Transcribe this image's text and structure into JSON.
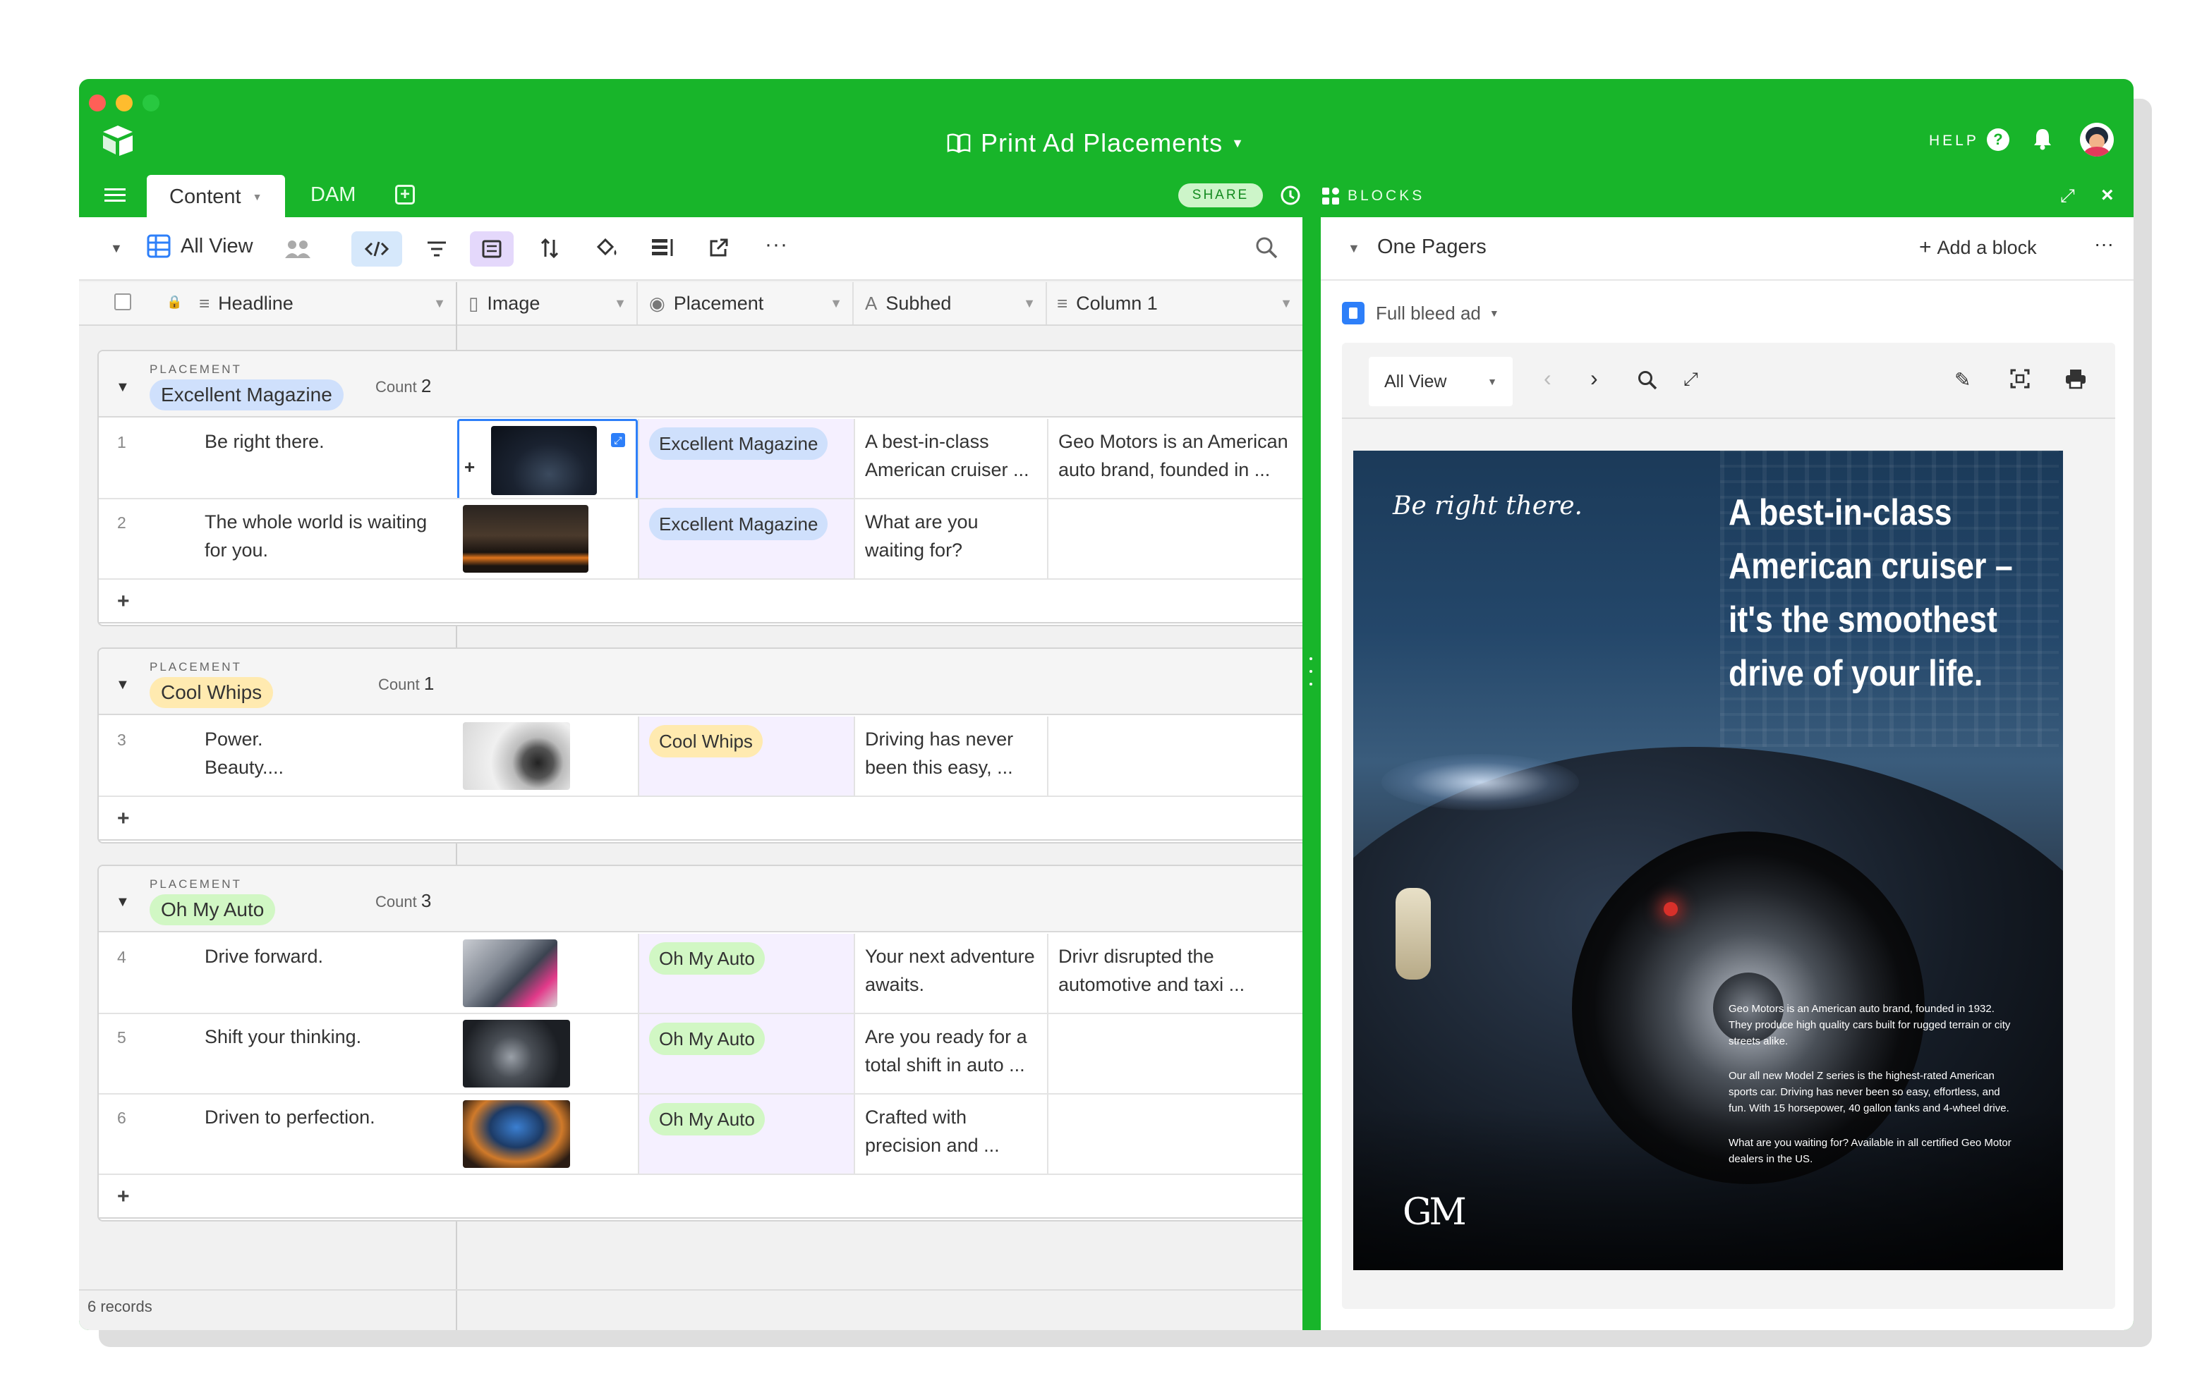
{
  "window": {
    "title": "Print Ad Placements",
    "brand_color": "#18b52a"
  },
  "tabs": [
    {
      "label": "Content",
      "active": true
    },
    {
      "label": "DAM",
      "active": false
    }
  ],
  "header": {
    "help": "HELP",
    "share": "SHARE",
    "blocks": "BLOCKS"
  },
  "view": {
    "name": "All View"
  },
  "columns": [
    {
      "label": "Headline",
      "icon": "long-text-icon"
    },
    {
      "label": "Image",
      "icon": "attachment-icon"
    },
    {
      "label": "Placement",
      "icon": "single-select-icon"
    },
    {
      "label": "Subhed",
      "icon": "text-icon"
    },
    {
      "label": "Column 1",
      "icon": "long-text-icon"
    }
  ],
  "groups": [
    {
      "field_label": "PLACEMENT",
      "name": "Excellent Magazine",
      "count_label": "Count",
      "count": "2",
      "rows": [
        {
          "num": "1",
          "headline": "Be right there.",
          "placement": "Excellent Magazine",
          "subhed": "A best-in-class American cruiser ...",
          "column1": "Geo Motors is an American auto brand, founded in ..."
        },
        {
          "num": "2",
          "headline": "The whole world is waiting for you.",
          "placement": "Excellent Magazine",
          "subhed": "What are you waiting for?",
          "column1": ""
        }
      ]
    },
    {
      "field_label": "PLACEMENT",
      "name": "Cool Whips",
      "count_label": "Count",
      "count": "1",
      "rows": [
        {
          "num": "3",
          "headline": "Power. Beauty....",
          "placement": "Cool Whips",
          "subhed": "Driving has never been this easy, ...",
          "column1": ""
        }
      ]
    },
    {
      "field_label": "PLACEMENT",
      "name": "Oh My Auto",
      "count_label": "Count",
      "count": "3",
      "rows": [
        {
          "num": "4",
          "headline": "Drive forward.",
          "placement": "Oh My Auto",
          "subhed": "Your next adventure awaits.",
          "column1": "Drivr disrupted the automotive and taxi ..."
        },
        {
          "num": "5",
          "headline": "Shift your thinking.",
          "placement": "Oh My Auto",
          "subhed": "Are you ready for a total shift in auto ...",
          "column1": ""
        },
        {
          "num": "6",
          "headline": "Driven to perfection.",
          "placement": "Oh My Auto",
          "subhed": "Crafted with precision and ...",
          "column1": ""
        }
      ]
    }
  ],
  "footer": {
    "records": "6 records"
  },
  "blocks_panel": {
    "dashboard_name": "One Pagers",
    "add_block": "Add a block",
    "block_name": "Full bleed ad",
    "view_select": "All View"
  },
  "poster": {
    "tagline": "Be right there.",
    "headline_lines": [
      "A best-in-class",
      "American cruiser –",
      "it's the smoothest",
      "drive of your life."
    ],
    "body1": "Geo Motors is an American auto brand, founded in 1932. They produce high quality cars built for rugged terrain or city streets alike.",
    "body2": "Our all new Model Z series is the highest-rated American sports car. Driving has never been so easy, effortless, and fun. With 15 horsepower, 40 gallon tanks and 4-wheel drive.",
    "body3": "What are you waiting for? Available in all certified Geo Motor dealers in the US.",
    "logo": "GM"
  }
}
